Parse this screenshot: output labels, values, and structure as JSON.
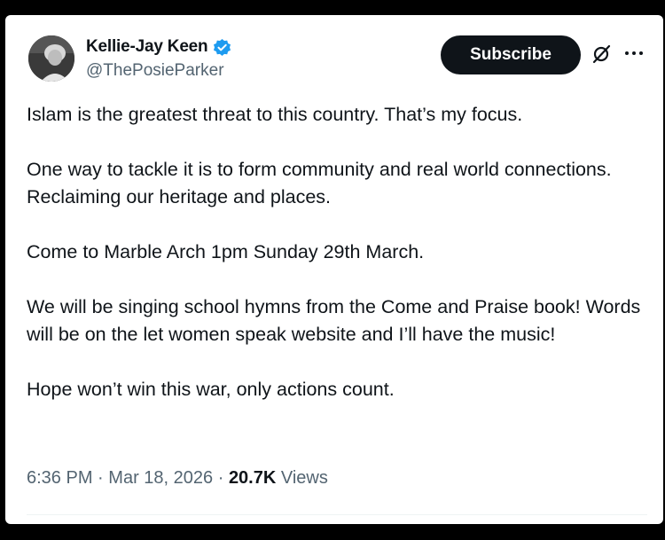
{
  "post": {
    "author_name": "Kellie-Jay Keen",
    "author_handle": "@ThePosieParker",
    "verified_color": "#1d9bf0",
    "subscribe_label": "Subscribe",
    "paragraphs": [
      "Islam is the greatest threat to this country.  That’s my focus.",
      "One way to tackle it is to form community and real world connections. Reclaiming our heritage and places.",
      "Come to Marble Arch 1pm Sunday 29th March.",
      "We will be singing school hymns from the Come and Praise book! Words will be on the let women speak website and I’ll have the music!",
      "Hope won’t win this war, only actions count."
    ],
    "time": "6:36 PM",
    "separator": "·",
    "date": "Mar 18, 2026",
    "views_count": "20.7K",
    "views_label": "Views"
  },
  "icons": {
    "verified": "verified-badge-icon",
    "grok": "grok-icon",
    "more": "more-options-icon"
  }
}
